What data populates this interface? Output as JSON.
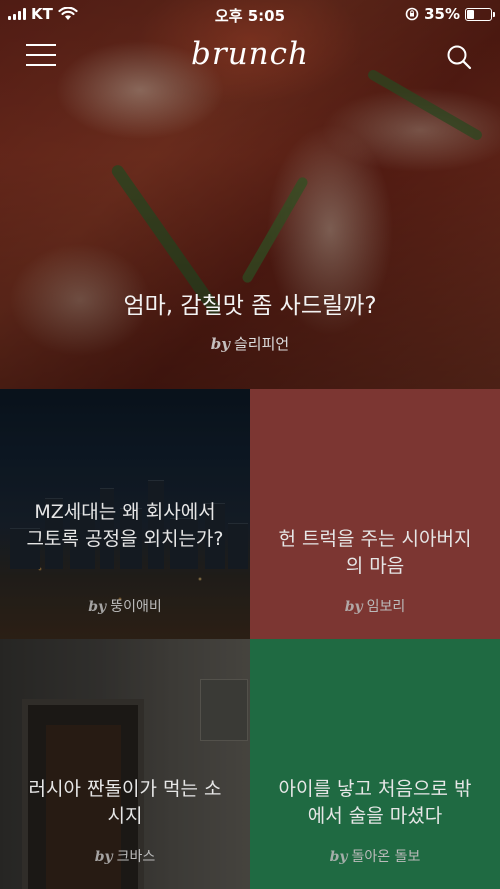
{
  "status_bar": {
    "carrier": "KT",
    "time": "오후 5:05",
    "battery": "35%",
    "battery_level": 0.35
  },
  "header": {
    "logo": "brunch"
  },
  "hero": {
    "title": "엄마, 감칠맛 좀 사드릴까?",
    "by": "by",
    "author": "슬리피언"
  },
  "cards": [
    {
      "title": "MZ세대는 왜 회사에서 그토록 공정을 외치는가?",
      "by": "by",
      "author": "뚱이애비"
    },
    {
      "title": "헌 트럭을 주는 시아버지의 마음",
      "by": "by",
      "author": "임보리"
    },
    {
      "title": "러시아 짠돌이가 먹는 소시지",
      "by": "by",
      "author": "크바스"
    },
    {
      "title": "아이를 낳고 처음으로 밖에서 술을 마셨다",
      "by": "by",
      "author": "돌아온 돌보"
    }
  ],
  "colors": {
    "card_red": "#7c3632",
    "card_green": "#1f6a42"
  }
}
